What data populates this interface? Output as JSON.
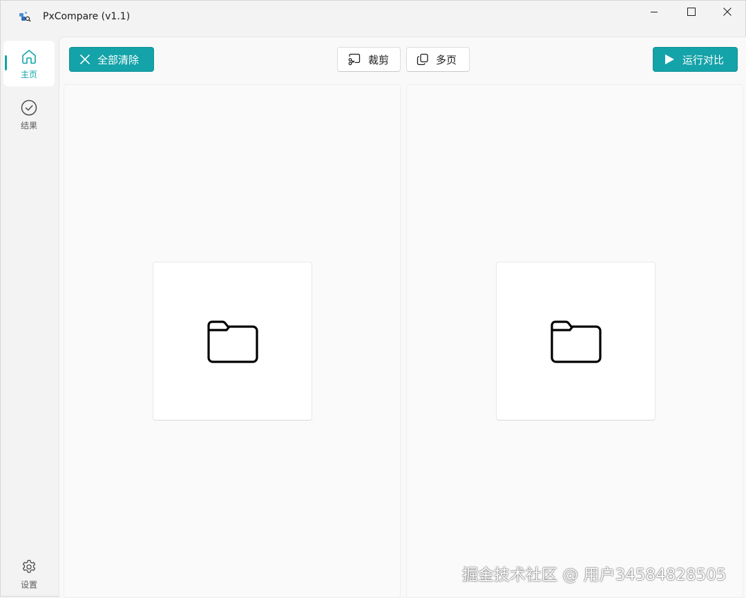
{
  "window": {
    "title": "PxCompare (v1.1)"
  },
  "sidebar": {
    "items": [
      {
        "label": "主页",
        "icon": "home-icon",
        "active": true
      },
      {
        "label": "结果",
        "icon": "check-circle-icon",
        "active": false
      },
      {
        "label": "设置",
        "icon": "gear-icon",
        "active": false
      }
    ]
  },
  "toolbar": {
    "clear_label": "全部清除",
    "crop_label": "裁剪",
    "multipage_label": "多页",
    "run_label": "运行对比"
  },
  "panels": {
    "left": {
      "icon": "folder-icon"
    },
    "right": {
      "icon": "folder-icon"
    }
  },
  "watermark": "掘金技术社区 @ 用户34584828505",
  "colors": {
    "accent": "#14a3a9",
    "background": "#f3f3f3"
  }
}
